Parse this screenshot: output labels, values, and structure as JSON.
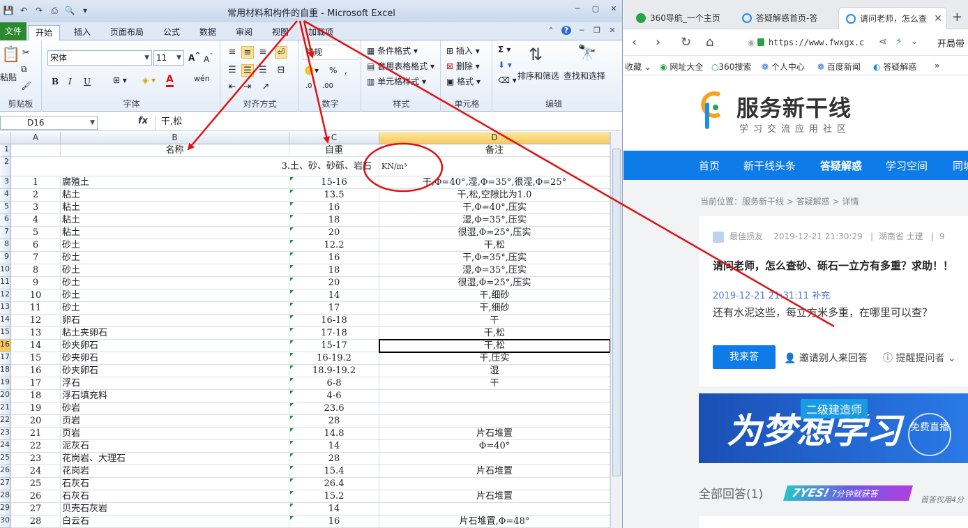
{
  "excel": {
    "title": "常用材料和构件的自重 - Microsoft Excel",
    "tabs": [
      "文件",
      "开始",
      "插入",
      "页面布局",
      "公式",
      "数据",
      "审阅",
      "视图",
      "加载项"
    ],
    "ribbon": {
      "font_name": "宋体",
      "font_size": "11",
      "number_format": "常规",
      "groups": {
        "clipboard": "剪贴板",
        "font": "字体",
        "align": "对齐方式",
        "number": "数字",
        "styles": "样式",
        "cells": "单元格",
        "edit": "编辑"
      },
      "paste_label": "粘贴",
      "cond_format": "条件格式",
      "table_format": "套用表格格式",
      "cell_styles": "单元格样式",
      "insert": "插入",
      "delete": "删除",
      "format": "格式",
      "sort_filter": "排序和筛选",
      "find_select": "查找和选择",
      "bold": "B",
      "italic": "I",
      "underline": "U",
      "fx": "fx"
    },
    "name_box": "D16",
    "formula": "干,松",
    "columns": [
      "A",
      "B",
      "C",
      "D"
    ],
    "row_numbers": [
      "1",
      "2",
      "3",
      "4",
      "5",
      "6",
      "7",
      "8",
      "9",
      "10",
      "11",
      "12",
      "13",
      "14",
      "15",
      "16",
      "17",
      "18",
      "19",
      "20",
      "21",
      "22",
      "23",
      "24",
      "25",
      "26",
      "27",
      "28",
      "29",
      "30"
    ],
    "header": {
      "name": "名称",
      "weight": "自重",
      "note": "备注"
    },
    "section_title": "3.土、砂、砂砾、岩石",
    "unit": "KN/m³",
    "rows": [
      {
        "n": "1",
        "name": "腐殖土",
        "w": "15-16",
        "note": "干,Φ=40°,湿,Φ=35°,很湿,Φ=25°"
      },
      {
        "n": "2",
        "name": "粘土",
        "w": "13.5",
        "note": "干,松,空隙比为1.0"
      },
      {
        "n": "3",
        "name": "粘土",
        "w": "16",
        "note": "干,Φ=40°,压实"
      },
      {
        "n": "4",
        "name": "粘土",
        "w": "18",
        "note": "湿,Φ=35°,压实"
      },
      {
        "n": "5",
        "name": "粘土",
        "w": "20",
        "note": "很湿,Φ=25°,压实"
      },
      {
        "n": "6",
        "name": "砂土",
        "w": "12.2",
        "note": "干,松"
      },
      {
        "n": "7",
        "name": "砂土",
        "w": "16",
        "note": "干,Φ=35°,压实"
      },
      {
        "n": "8",
        "name": "砂土",
        "w": "18",
        "note": "湿,Φ=35°,压实"
      },
      {
        "n": "9",
        "name": "砂土",
        "w": "20",
        "note": "很湿,Φ=25°,压实"
      },
      {
        "n": "10",
        "name": "砂土",
        "w": "14",
        "note": "干,细砂"
      },
      {
        "n": "11",
        "name": "砂土",
        "w": "17",
        "note": "干,细砂"
      },
      {
        "n": "12",
        "name": "卵石",
        "w": "16-18",
        "note": "干"
      },
      {
        "n": "13",
        "name": "粘土夹卵石",
        "w": "17-18",
        "note": "干,松"
      },
      {
        "n": "14",
        "name": "砂夹卵石",
        "w": "15-17",
        "note": "干,松"
      },
      {
        "n": "15",
        "name": "砂夹卵石",
        "w": "16-19.2",
        "note": "干,压实"
      },
      {
        "n": "16",
        "name": "砂夹卵石",
        "w": "18.9-19.2",
        "note": "湿"
      },
      {
        "n": "17",
        "name": "浮石",
        "w": "6-8",
        "note": "干"
      },
      {
        "n": "18",
        "name": "浮石填充料",
        "w": "4-6",
        "note": ""
      },
      {
        "n": "19",
        "name": "砂岩",
        "w": "23.6",
        "note": ""
      },
      {
        "n": "20",
        "name": "页岩",
        "w": "28",
        "note": ""
      },
      {
        "n": "21",
        "name": "页岩",
        "w": "14.8",
        "note": "片石堆置"
      },
      {
        "n": "22",
        "name": "泥灰石",
        "w": "14",
        "note": "Φ=40°"
      },
      {
        "n": "23",
        "name": "花岗岩、大理石",
        "w": "28",
        "note": ""
      },
      {
        "n": "24",
        "name": "花岗岩",
        "w": "15.4",
        "note": "片石堆置"
      },
      {
        "n": "25",
        "name": "石灰石",
        "w": "26.4",
        "note": ""
      },
      {
        "n": "26",
        "name": "石灰石",
        "w": "15.2",
        "note": "片石堆置"
      },
      {
        "n": "27",
        "name": "贝壳石灰岩",
        "w": "14",
        "note": ""
      },
      {
        "n": "28",
        "name": "白云石",
        "w": "16",
        "note": "片石堆置,Φ=48°"
      }
    ]
  },
  "browser": {
    "tabs": [
      {
        "label": "360导航_一个主页",
        "color": "#2aa24a"
      },
      {
        "label": "答疑解惑首页-答",
        "color": "#1a8fe6"
      },
      {
        "label": "请问老师，怎么查",
        "color": "#1a8fe6"
      }
    ],
    "url": "https://www.fwxgx.c",
    "url_right": "开局带",
    "bookmarks": [
      "收藏",
      "网址大全",
      "360搜索",
      "个人中心",
      "百度新闻",
      "答疑解惑"
    ],
    "site_title": "服务新干线",
    "site_sub": "学习交流应用社区",
    "nav": [
      "首页",
      "新干线头条",
      "答疑解惑",
      "学习空间",
      "同城"
    ],
    "breadcrumb": "当前位置：服务新干线 > 答疑解惑 > 详情",
    "question": {
      "user": "最佳损友",
      "time": "2019-12-21 21:30:29",
      "location": "湖南省 土建",
      "views": "9",
      "title": "请问老师，怎么查砂、砾石一立方有多重？求助！！",
      "supp_time": "2019-12-21 21:31:11 补充",
      "body": "还有水泥这些，每立方米多重，在哪里可以查？",
      "answer_btn": "我来答",
      "invite": "邀请别人来回答",
      "remind": "提醒提问者"
    },
    "banner": {
      "tag": "二级建造师",
      "big": "为梦想学习",
      "circle": "免费直播"
    },
    "all_answers": "全部回答(1)",
    "yes_badge": "7YES!",
    "yes_text": "7分钟就获答",
    "yes_note": "首答仅用4分"
  },
  "colors": {
    "excel_green": "#2b8a2e",
    "site_blue": "#0d7be8",
    "annotation_red": "#e01010"
  }
}
